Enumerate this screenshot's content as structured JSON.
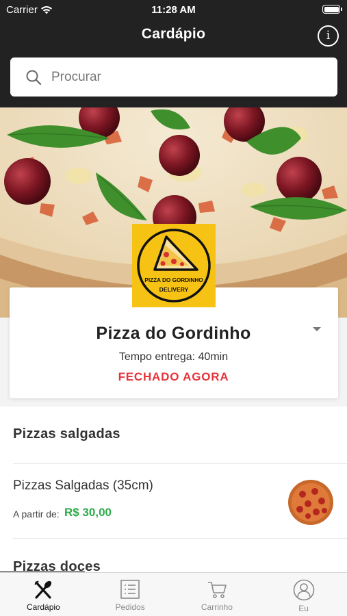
{
  "status_bar": {
    "carrier": "Carrier",
    "time": "11:28 AM"
  },
  "header": {
    "title": "Cardápio"
  },
  "search": {
    "placeholder": "Procurar"
  },
  "restaurant": {
    "logo_text": "PIZZA DO GORDINHO",
    "logo_subtext": "DELIVERY",
    "name": "Pizza do Gordinho",
    "delivery_time": "Tempo entrega: 40min",
    "status": "FECHADO AGORA"
  },
  "menu": {
    "sections": [
      "Pizzas salgadas",
      "Pizzas doces"
    ],
    "items": [
      {
        "name": "Pizzas Salgadas (35cm)",
        "price_label": "A partir de:",
        "price": "R$ 30,00"
      }
    ]
  },
  "tabs": [
    {
      "label": "Cardápio",
      "icon": "cutlery-icon",
      "active": true
    },
    {
      "label": "Pedidos",
      "icon": "list-icon",
      "active": false
    },
    {
      "label": "Carrinho",
      "icon": "cart-icon",
      "active": false
    },
    {
      "label": "Eu",
      "icon": "user-icon",
      "active": false
    }
  ],
  "colors": {
    "header_bg": "#222222",
    "closed_red": "#e5323a",
    "price_green": "#2eaa4a",
    "logo_yellow": "#f6c315"
  }
}
